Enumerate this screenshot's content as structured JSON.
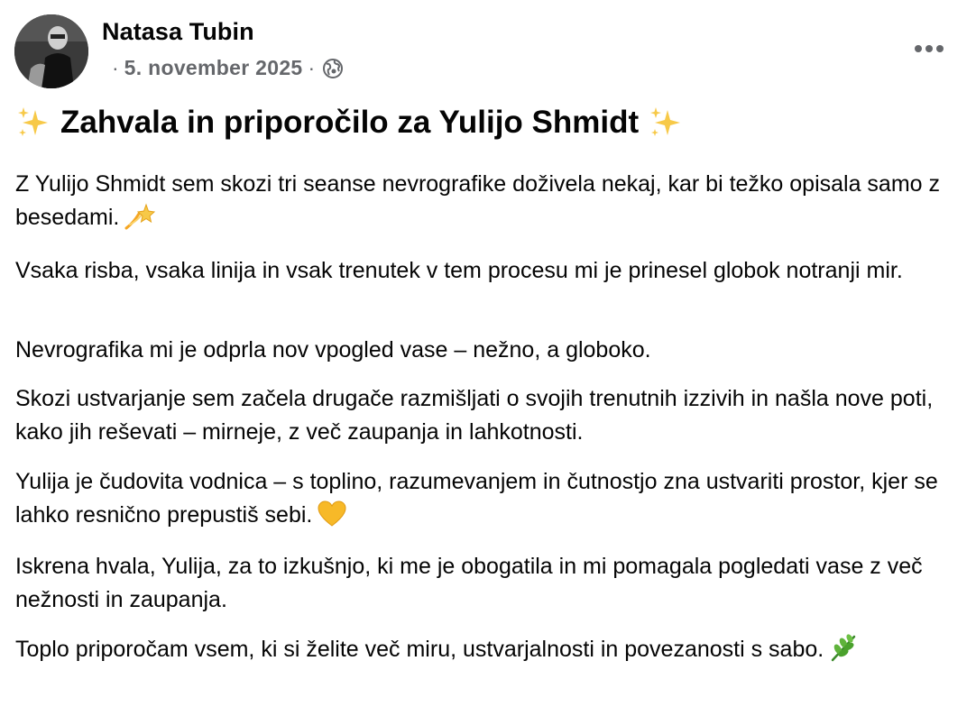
{
  "post": {
    "author": "Natasa Tubin",
    "meta": {
      "separator_left": "·",
      "date": "5. november 2025",
      "separator_right": "·",
      "audience_icon": "globe-icon"
    },
    "more_icon": "more-options-icon",
    "title": "Zahvala in priporočilo za Yulijo Shmidt",
    "title_emoji": "sparkles-icon",
    "paragraphs": [
      {
        "text": "Z Yulijo Shmidt sem skozi tri seanse nevrografike doživela nekaj, kar bi težko opisala samo z besedami.",
        "emoji": "dizzy-star-icon"
      },
      {
        "text": "Vsaka risba, vsaka linija in vsak trenutek v tem procesu mi je prinesel globok notranji mir."
      },
      {
        "text": "Nevrografika mi je odprla nov vpogled vase – nežno, a globoko."
      },
      {
        "text": "Skozi ustvarjanje sem začela drugače razmišljati o svojih trenutnih izzivih in našla nove poti, kako jih reševati – mirneje, z več zaupanja in lahkotnosti."
      },
      {
        "text": "Yulija je čudovita vodnica – s toplino, razumevanjem in čutnostjo zna ustvariti prostor, kjer se lahko resnično prepustiš sebi.",
        "emoji": "yellow-heart-icon"
      },
      {
        "text": "Iskrena hvala, Yulija, za to izkušnjo, ki me je obogatila in mi pomagala pogledati vase z več nežnosti in zaupanja."
      },
      {
        "text": "Toplo priporočam vsem, ki si želite več miru, ustvarjalnosti in povezanosti s sabo.",
        "emoji": "herb-icon"
      }
    ]
  }
}
